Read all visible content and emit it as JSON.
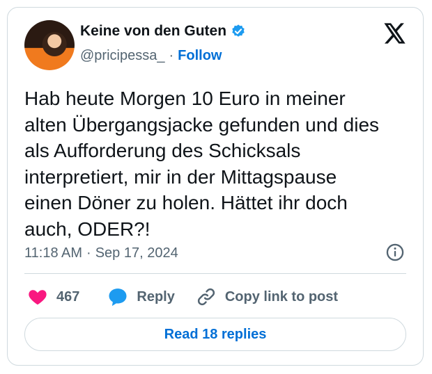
{
  "author": {
    "name": "Keine von den Guten",
    "handle": "@pricipessa_",
    "separator": "·",
    "follow_label": "Follow"
  },
  "tweet": {
    "text": "Hab heute Morgen 10 Euro in meiner\nalten Übergangsjacke gefunden und dies\nals Aufforderung des Schicksals\ninterpretiert, mir in der Mittagspause\neinen Döner zu holen. Hättet ihr doch\nauch, ODER?!",
    "time": "11:18 AM",
    "meta_separator": "·",
    "date": "Sep 17, 2024"
  },
  "actions": {
    "like_count": "467",
    "reply_label": "Reply",
    "copy_label": "Copy link to post"
  },
  "read_replies_label": "Read 18 replies",
  "icons": {
    "verified": "verified-badge-icon",
    "platform": "x-logo-icon",
    "info": "info-icon",
    "like": "heart-icon",
    "reply": "speech-bubble-icon",
    "copy": "link-icon"
  },
  "colors": {
    "accent": "#006fd6",
    "like": "#f91880",
    "reply": "#1d9bf0",
    "secondary_text": "#536471",
    "border": "#cfd9de"
  }
}
